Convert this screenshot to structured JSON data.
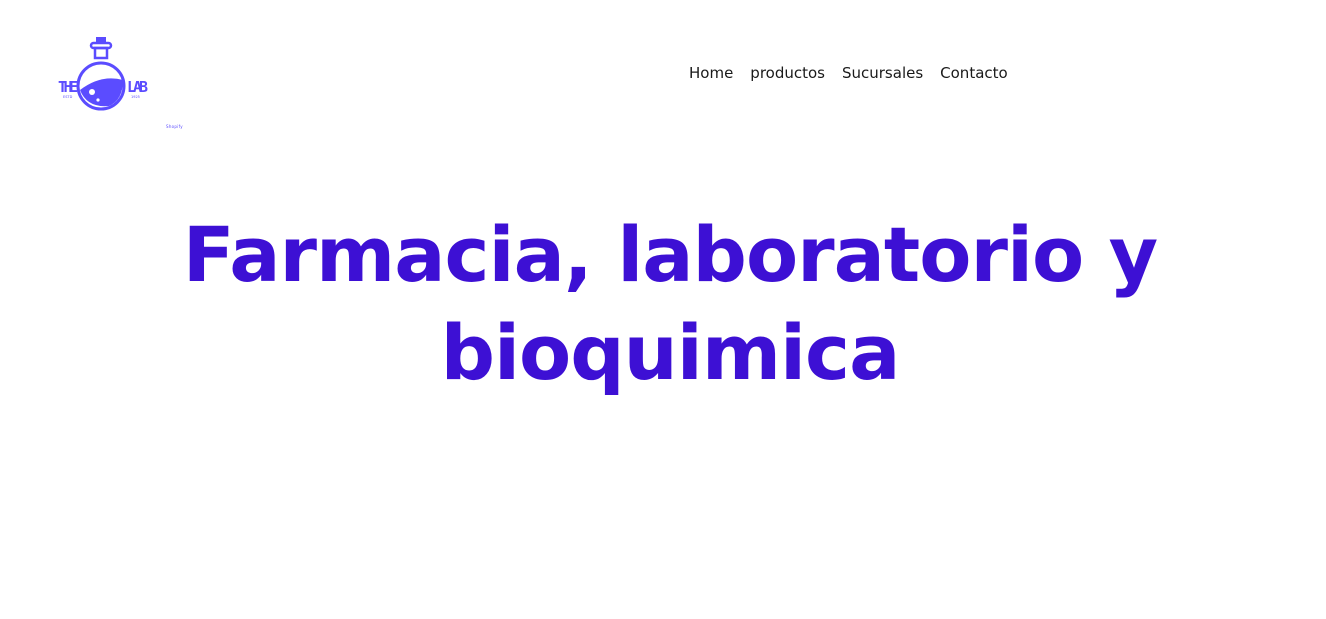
{
  "brand": {
    "logo_text_left": "THE",
    "logo_text_right": "LAB",
    "logo_small_left": "ESTD",
    "logo_small_right": "1925",
    "caption": "Shopify",
    "accent_color": "#5b4cff"
  },
  "nav": {
    "items": [
      {
        "label": "Home"
      },
      {
        "label": "productos"
      },
      {
        "label": "Sucursales"
      },
      {
        "label": "Contacto"
      }
    ]
  },
  "hero": {
    "title": "Farmacia, laboratorio y bioquimica",
    "title_color": "#3d10d4"
  }
}
